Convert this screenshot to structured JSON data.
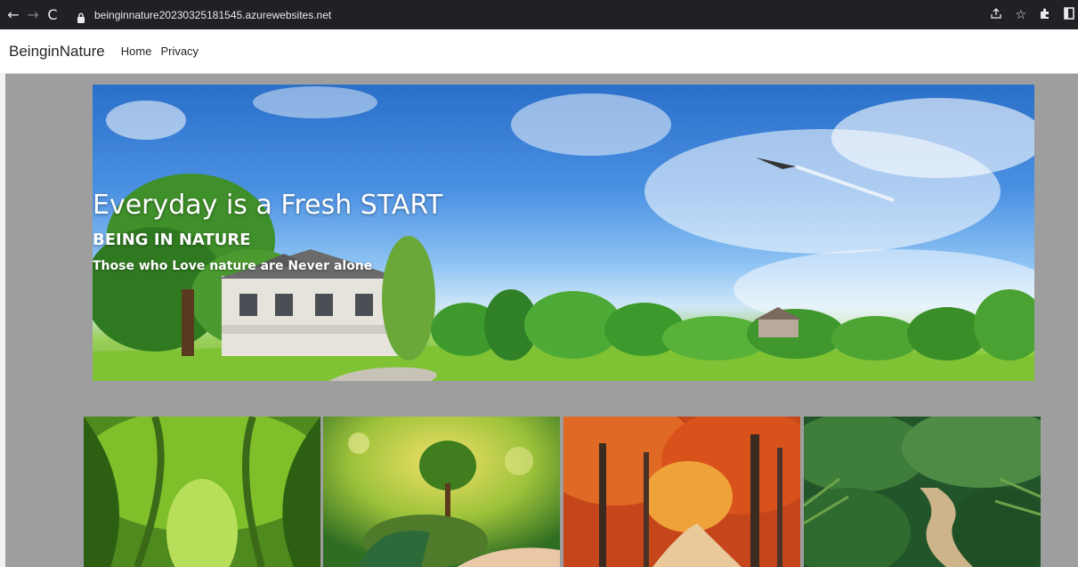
{
  "browser": {
    "url": "beinginnature20230325181545.azurewebsites.net",
    "back_icon": "back-arrow-icon",
    "forward_icon": "forward-arrow-icon",
    "reload_icon": "reload-icon",
    "lock_icon": "lock-icon",
    "right_icons": [
      "share-icon",
      "star-icon",
      "extensions-icon",
      "window-icon"
    ]
  },
  "nav": {
    "brand": "BeinginNature",
    "links": [
      "Home",
      "Privacy"
    ]
  },
  "hero": {
    "title": "Everyday is a Fresh START",
    "subtitle": "BEING IN NATURE",
    "tagline": "Those who Love nature are Never alone"
  },
  "gallery": [
    {
      "alt": "green forest tunnel"
    },
    {
      "alt": "tree in hands"
    },
    {
      "alt": "autumn forest path"
    },
    {
      "alt": "fern forest boardwalk"
    }
  ],
  "colors": {
    "page_bg": "#9e9e9e",
    "chrome_bg": "#202124",
    "nav_bg": "#ffffff",
    "text": "#212529"
  }
}
